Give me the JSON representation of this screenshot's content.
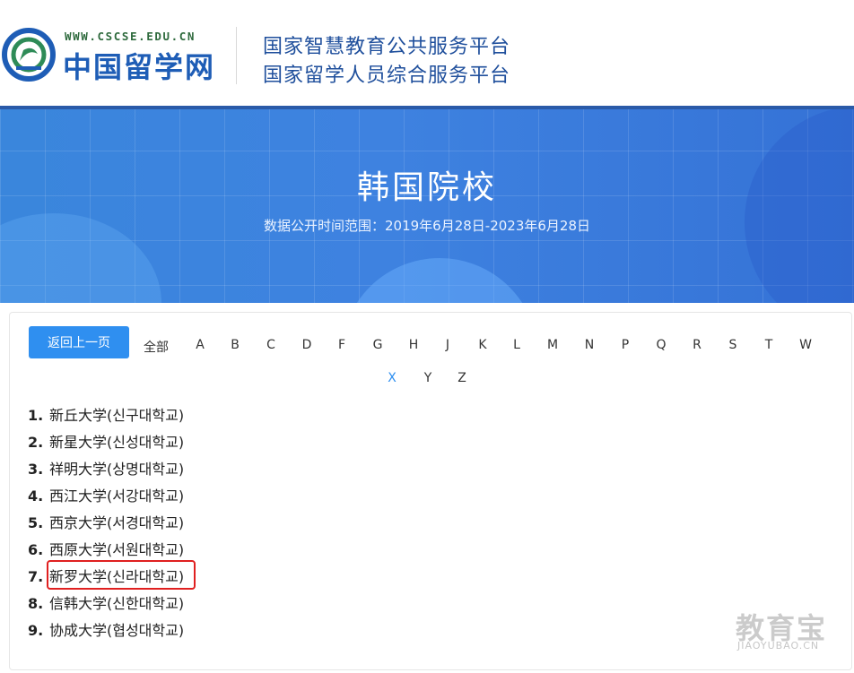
{
  "header": {
    "logo_url": "WWW.CSCSE.EDU.CN",
    "logo_name": "中国留学网",
    "platform_line1": "国家智慧教育公共服务平台",
    "platform_line2": "国家留学人员综合服务平台"
  },
  "banner": {
    "title": "韩国院校",
    "subtitle": "数据公开时间范围：2019年6月28日-2023年6月28日"
  },
  "filter": {
    "back_label": "返回上一页",
    "all_label": "全部",
    "letters": [
      "A",
      "B",
      "C",
      "D",
      "F",
      "G",
      "H",
      "J",
      "K",
      "L",
      "M",
      "N",
      "P",
      "Q",
      "R",
      "S",
      "T",
      "W",
      "X",
      "Y",
      "Z"
    ],
    "active_letter": "X"
  },
  "schools": [
    {
      "num": "1.",
      "name": "新丘大学(신구대학교)"
    },
    {
      "num": "2.",
      "name": "新星大学(신성대학교)"
    },
    {
      "num": "3.",
      "name": "祥明大学(상명대학교)"
    },
    {
      "num": "4.",
      "name": "西江大学(서강대학교)"
    },
    {
      "num": "5.",
      "name": "西京大学(서경대학교)"
    },
    {
      "num": "6.",
      "name": "西原大学(서원대학교)"
    },
    {
      "num": "7.",
      "name": "新罗大学(신라대학교)"
    },
    {
      "num": "8.",
      "name": "信韩大学(신한대학교)"
    },
    {
      "num": "9.",
      "name": "协成大学(협성대학교)"
    }
  ],
  "highlighted_index": 6,
  "watermark": {
    "cn": "教育宝",
    "en": "JIAOYUBAO.CN"
  },
  "colors": {
    "accent": "#2f8ff0",
    "banner_blue": "#3e82e0",
    "logo_blue": "#1e5db6",
    "highlight": "#e02020"
  }
}
